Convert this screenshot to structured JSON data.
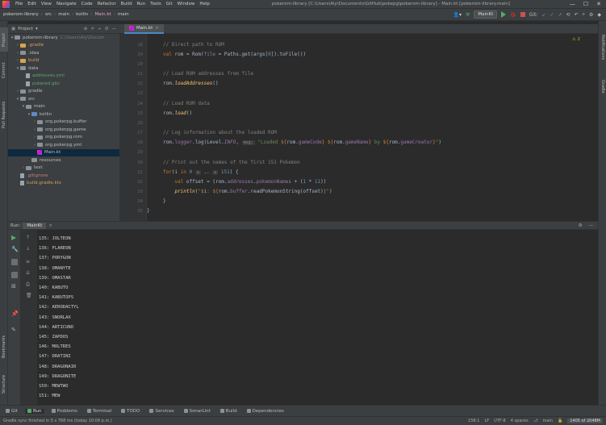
{
  "window": {
    "menu": [
      "File",
      "Edit",
      "View",
      "Navigate",
      "Code",
      "Refactor",
      "Build",
      "Run",
      "Tools",
      "Git",
      "Window",
      "Help"
    ],
    "title": "pokerom-library [C:\\Users\\Aly\\Documents\\GitHub\\pokepg\\pokerom-library] - Main.kt [pokerom-library.main]",
    "controls": [
      "—",
      "☐",
      "✕"
    ]
  },
  "breadcrumb": [
    "pokerom-library",
    "src",
    "main",
    "kotlin",
    "Main.kt",
    "main"
  ],
  "toolbar": {
    "run_config": "MainKt",
    "git_label": "Git:"
  },
  "project_panel": {
    "title": "Project",
    "tree": [
      {
        "depth": 0,
        "arrow": "▾",
        "icon": "folder",
        "label": "pokerom-library",
        "hint": "C:\\Users\\Aly\\Docum"
      },
      {
        "depth": 1,
        "arrow": "›",
        "icon": "folder-orange",
        "label": ".gradle",
        "style": "orange"
      },
      {
        "depth": 1,
        "arrow": "›",
        "icon": "folder",
        "label": ".idea"
      },
      {
        "depth": 1,
        "arrow": "›",
        "icon": "folder-orange",
        "label": "build",
        "style": "orange"
      },
      {
        "depth": 1,
        "arrow": "▾",
        "icon": "folder",
        "label": "data"
      },
      {
        "depth": 2,
        "arrow": "",
        "icon": "file",
        "label": "addresses.yml",
        "style": "green"
      },
      {
        "depth": 2,
        "arrow": "",
        "icon": "file",
        "label": "pokered.gbc",
        "style": "green"
      },
      {
        "depth": 1,
        "arrow": "›",
        "icon": "folder",
        "label": "gradle"
      },
      {
        "depth": 1,
        "arrow": "▾",
        "icon": "folder",
        "label": "src"
      },
      {
        "depth": 2,
        "arrow": "▾",
        "icon": "folder",
        "label": "main"
      },
      {
        "depth": 3,
        "arrow": "▾",
        "icon": "folder-blue",
        "label": "kotlin"
      },
      {
        "depth": 4,
        "arrow": "›",
        "icon": "folder",
        "label": "org.pokerpg.buffer"
      },
      {
        "depth": 4,
        "arrow": "›",
        "icon": "folder",
        "label": "org.pokerpg.game"
      },
      {
        "depth": 4,
        "arrow": "›",
        "icon": "folder",
        "label": "org.pokerpg.rom"
      },
      {
        "depth": 4,
        "arrow": "›",
        "icon": "folder",
        "label": "org.pokerpg.yml"
      },
      {
        "depth": 4,
        "arrow": "",
        "icon": "kt",
        "label": "Main.kt",
        "selected": true
      },
      {
        "depth": 3,
        "arrow": "",
        "icon": "folder",
        "label": "resources"
      },
      {
        "depth": 2,
        "arrow": "›",
        "icon": "folder",
        "label": "test"
      },
      {
        "depth": 1,
        "arrow": "",
        "icon": "file",
        "label": ".gitignore",
        "style": "red"
      },
      {
        "depth": 1,
        "arrow": "",
        "icon": "file",
        "label": "build.gradle.kts",
        "style": "orange"
      }
    ]
  },
  "editor": {
    "tab": "Main.kt",
    "line_numbers": [
      "18",
      "19",
      "20",
      "21",
      "22",
      "23",
      "24",
      "25",
      "26",
      "27",
      "28",
      "29",
      "30",
      "31",
      "32",
      "33",
      "34",
      "35"
    ],
    "inspection": "⚠ 2"
  },
  "run_panel": {
    "label": "Run:",
    "tab": "MainKt",
    "output": [
      "135: JOLTEON",
      "136: FLAREON",
      "137: PORYGON",
      "138: OMANYTE",
      "139: OMASTAR",
      "140: KABUTO",
      "141: KABUTOPS",
      "142: AERODACTYL",
      "143: SNORLAX",
      "144: ARTICUNO",
      "145: ZAPDOS",
      "146: MOLTRES",
      "147: DRATINI",
      "148: DRAGONAIR",
      "149: DRAGONITE",
      "150: MEWTWO",
      "151: MEW"
    ]
  },
  "bottom_tabs": [
    "Git",
    "Run",
    "Problems",
    "Terminal",
    "TODO",
    "Services",
    "SonarLint",
    "Build",
    "Dependencies"
  ],
  "left_strip": [
    "Project",
    "Commit",
    "Pull Requests",
    "Bookmarks",
    "Structure"
  ],
  "right_strip": [
    "Notifications",
    "Gradle"
  ],
  "status": {
    "message": "Gradle sync finished in 5 s 768 ms (today 10:09 p.m.)",
    "position": "158:1",
    "line_sep": "LF",
    "encoding": "UTF-8",
    "indent": "4 spaces",
    "branch": "main",
    "memory": "1405 of 2048M"
  }
}
